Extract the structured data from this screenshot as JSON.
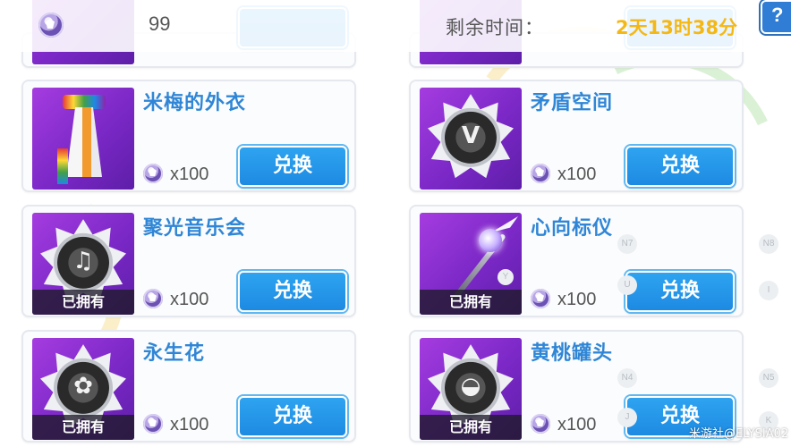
{
  "header": {
    "currency_icon": "currency-coin-icon",
    "currency_count": "99",
    "remaining_label": "剩余时间：",
    "remaining_value": "2天13时38分",
    "corner_button_glyph": "?"
  },
  "items": [
    {
      "name": "米梅的外衣",
      "cost": "x100",
      "redeem_label": "兑换",
      "owned": false
    },
    {
      "name": "矛盾空间",
      "cost": "x100",
      "redeem_label": "兑换",
      "owned": false
    },
    {
      "name": "聚光音乐会",
      "cost": "x100",
      "redeem_label": "兑换",
      "owned": true,
      "owned_label": "已拥有"
    },
    {
      "name": "心向标仪",
      "cost": "x100",
      "redeem_label": "兑换",
      "owned": true,
      "owned_label": "已拥有"
    },
    {
      "name": "永生花",
      "cost": "x100",
      "redeem_label": "兑换",
      "owned": true,
      "owned_label": "已拥有"
    },
    {
      "name": "黄桃罐头",
      "cost": "x100",
      "redeem_label": "兑换",
      "owned": true,
      "owned_label": "已拥有"
    }
  ],
  "side_tags": [
    "N7",
    "N8",
    "U",
    "I",
    "Y",
    "N4",
    "N5",
    "J",
    "K"
  ],
  "watermark": "米游社@ELYSIA02",
  "colors": {
    "accent_blue": "#2f86d6",
    "button_blue": "#1d8ae2",
    "time_gold": "#f4b816",
    "thumb_purple": "#7b28c7"
  }
}
